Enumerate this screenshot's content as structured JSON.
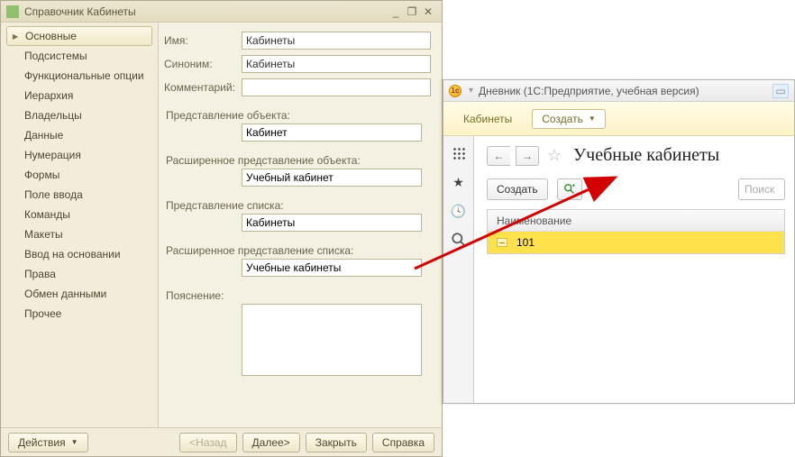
{
  "cfg": {
    "title": "Справочник Кабинеты",
    "sidebar": [
      "Основные",
      "Подсистемы",
      "Функциональные опции",
      "Иерархия",
      "Владельцы",
      "Данные",
      "Нумерация",
      "Формы",
      "Поле ввода",
      "Команды",
      "Макеты",
      "Ввод на основании",
      "Права",
      "Обмен данными",
      "Прочее"
    ],
    "labels": {
      "name": "Имя:",
      "synonym": "Синоним:",
      "comment": "Комментарий:",
      "objPres": "Представление объекта:",
      "objPresExt": "Расширенное представление объекта:",
      "listPres": "Представление списка:",
      "listPresExt": "Расширенное представление списка:",
      "explain": "Пояснение:"
    },
    "values": {
      "name": "Кабинеты",
      "synonym": "Кабинеты",
      "comment": "",
      "objPres": "Кабинет",
      "objPresExt": "Учебный кабинет",
      "listPres": "Кабинеты",
      "listPresExt": "Учебные кабинеты"
    },
    "footer": {
      "actions": "Действия",
      "back": "<Назад",
      "next": "Далее>",
      "close": "Закрыть",
      "help": "Справка"
    }
  },
  "ent": {
    "title": "Дневник  (1С:Предприятие, учебная версия)",
    "toolbar": {
      "link": "Кабинеты",
      "create": "Создать"
    },
    "content": {
      "pageTitle": "Учебные кабинеты",
      "createBtn": "Создать",
      "searchPlaceholder": "Поиск",
      "header": "Наименование",
      "rows": [
        "101"
      ]
    }
  }
}
